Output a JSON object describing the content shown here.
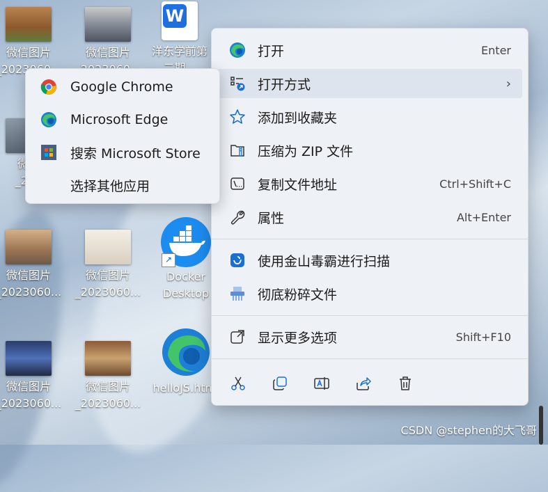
{
  "desktop": {
    "icons": [
      {
        "label1": "微信图片",
        "label2": "_2023060..."
      },
      {
        "label1": "微信图片",
        "label2": "_2023060..."
      },
      {
        "label1": "洋东学前第",
        "label2": "二期..."
      },
      {
        "label1": "微信",
        "label2": "_202"
      },
      {
        "label1": "微信图片",
        "label2": "_2023060..."
      },
      {
        "label1": "微信图片",
        "label2": "_2023060..."
      },
      {
        "label1": "Docker",
        "label2": "Desktop"
      },
      {
        "label1": "微信图片",
        "label2": "_2023060..."
      },
      {
        "label1": "微信图片",
        "label2": "_2023060..."
      },
      {
        "label1": "helloJS.html",
        "label2": ""
      }
    ]
  },
  "context_menu": {
    "items": [
      {
        "label": "打开",
        "shortcut": "Enter",
        "icon": "edge-icon"
      },
      {
        "label": "打开方式",
        "shortcut": "",
        "icon": "open-with-icon"
      },
      {
        "label": "添加到收藏夹",
        "shortcut": "",
        "icon": "star-icon"
      },
      {
        "label": "压缩为 ZIP 文件",
        "shortcut": "",
        "icon": "zip-icon"
      },
      {
        "label": "复制文件地址",
        "shortcut": "Ctrl+Shift+C",
        "icon": "copy-path-icon"
      },
      {
        "label": "属性",
        "shortcut": "Alt+Enter",
        "icon": "wrench-icon"
      },
      {
        "label": "使用金山毒霸进行扫描",
        "shortcut": "",
        "icon": "antivirus-icon"
      },
      {
        "label": "彻底粉碎文件",
        "shortcut": "",
        "icon": "shredder-icon"
      },
      {
        "label": "显示更多选项",
        "shortcut": "Shift+F10",
        "icon": "more-options-icon"
      }
    ],
    "bottom_icons": [
      "cut-icon",
      "copy-icon",
      "rename-icon",
      "share-icon",
      "delete-icon"
    ]
  },
  "submenu": {
    "items": [
      {
        "label": "Google Chrome",
        "icon": "chrome-icon"
      },
      {
        "label": "Microsoft Edge",
        "icon": "edge-icon"
      },
      {
        "label": "搜索 Microsoft Store",
        "icon": "store-icon"
      },
      {
        "label": "选择其他应用",
        "icon": ""
      }
    ]
  },
  "watermark": "CSDN @stephen的大飞哥",
  "colors": {
    "accent": "#1a6fd1",
    "menu_bg": "#eef2f7",
    "hover": "#dde4ee"
  }
}
